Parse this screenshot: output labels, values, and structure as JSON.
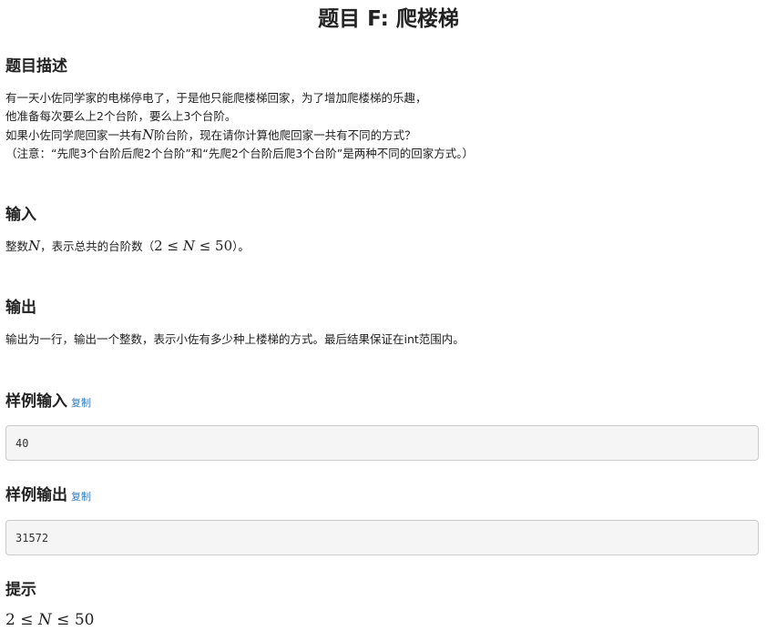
{
  "problem": {
    "title": "题目 F: 爬楼梯"
  },
  "description": {
    "heading": "题目描述",
    "line1": "有一天小佐同学家的电梯停电了，于是他只能爬楼梯回家，为了增加爬楼梯的乐趣，",
    "line2": "他准备每次要么上2个台阶，要么上3个台阶。",
    "line3_pre": "如果小佐同学爬回家一共有",
    "line3_var": "N",
    "line3_post": "阶台阶，现在请你计算他爬回家一共有不同的方式？",
    "line4": "（注意：“先爬3个台阶后爬2个台阶”和“先爬2个台阶后爬3个台阶”是两种不同的回家方式。）"
  },
  "input": {
    "heading": "输入",
    "text_pre": "整数",
    "var": "N",
    "text_mid": "，表示总共的台阶数（",
    "range_low": "2",
    "le1": " ≤ ",
    "range_var": "N",
    "le2": " ≤ ",
    "range_high": "50",
    "text_post": "）。"
  },
  "output": {
    "heading": "输出",
    "text": "输出为一行，输出一个整数，表示小佐有多少种上楼梯的方式。最后结果保证在int范围内。"
  },
  "sample_input": {
    "heading": "样例输入",
    "copy_label": "复制",
    "value": "40"
  },
  "sample_output": {
    "heading": "样例输出",
    "copy_label": "复制",
    "value": "31572"
  },
  "hint": {
    "heading": "提示",
    "low": "2",
    "le1": " ≤ ",
    "var": "N",
    "le2": " ≤ ",
    "high": "50"
  }
}
